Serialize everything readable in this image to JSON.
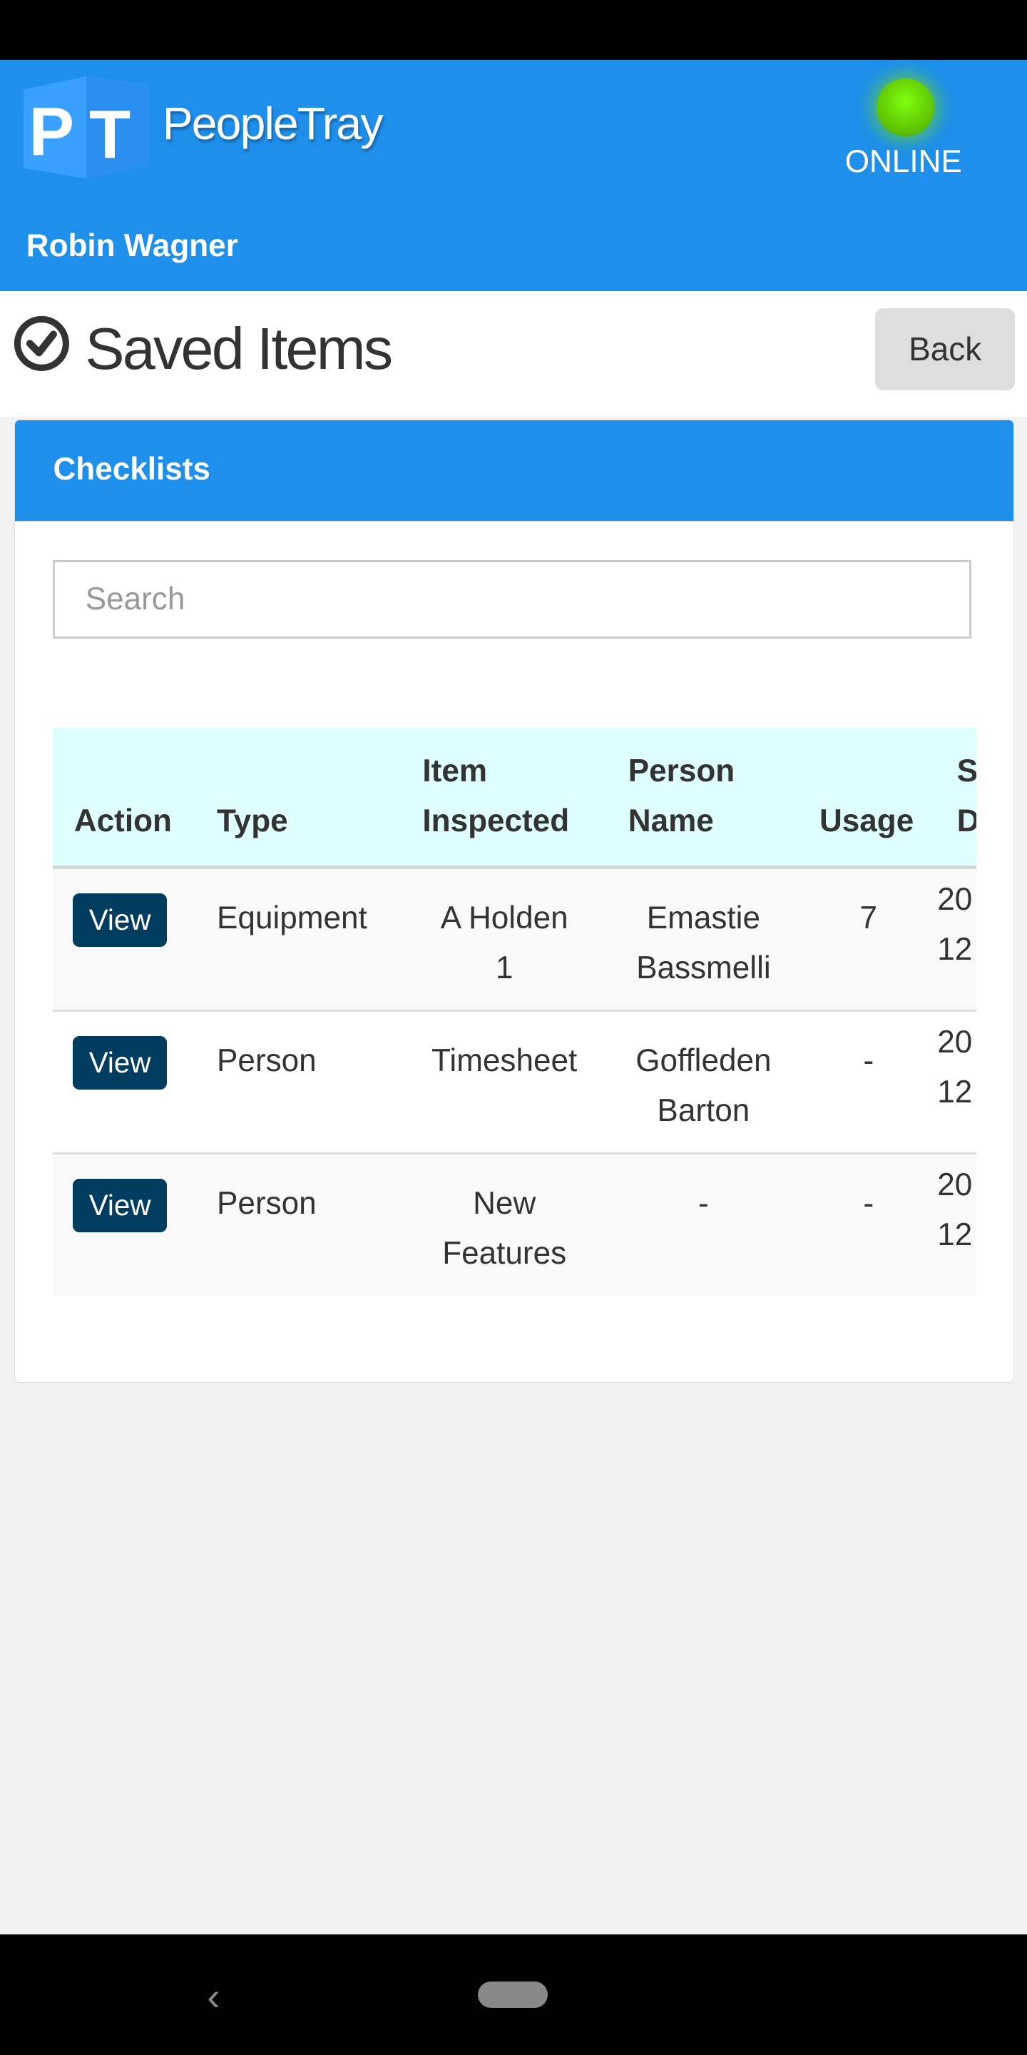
{
  "header": {
    "app_name": "PeopleTray",
    "logo_text": "PT",
    "status": "ONLINE",
    "status_color": "#66dd00",
    "user_name": "Robin Wagner",
    "brand_color": "#1e8fea"
  },
  "page": {
    "title": "Saved Items",
    "title_icon": "check-circle-icon",
    "back_label": "Back"
  },
  "card": {
    "title": "Checklists",
    "search_placeholder": "Search",
    "search_value": ""
  },
  "table": {
    "columns": [
      {
        "line1": "",
        "line2": "Action"
      },
      {
        "line1": "",
        "line2": "Type"
      },
      {
        "line1": "Item",
        "line2": "Inspected"
      },
      {
        "line1": "Person",
        "line2": "Name"
      },
      {
        "line1": "",
        "line2": "Usage"
      },
      {
        "line1": "S",
        "line2": "D"
      }
    ],
    "rows": [
      {
        "action": "View",
        "type": "Equipment",
        "item1": "A Holden",
        "item2": "1",
        "person1": "Emastie",
        "person2": "Bassmelli",
        "usage": "7",
        "date1": "20",
        "date2": "12"
      },
      {
        "action": "View",
        "type": "Person",
        "item1": "Timesheet",
        "item2": "",
        "person1": "Goffleden",
        "person2": "Barton",
        "usage": "-",
        "date1": "20",
        "date2": "12"
      },
      {
        "action": "View",
        "type": "Person",
        "item1": "New",
        "item2": "Features",
        "person1": "-",
        "person2": "",
        "usage": "-",
        "date1": "20",
        "date2": "12"
      }
    ]
  }
}
